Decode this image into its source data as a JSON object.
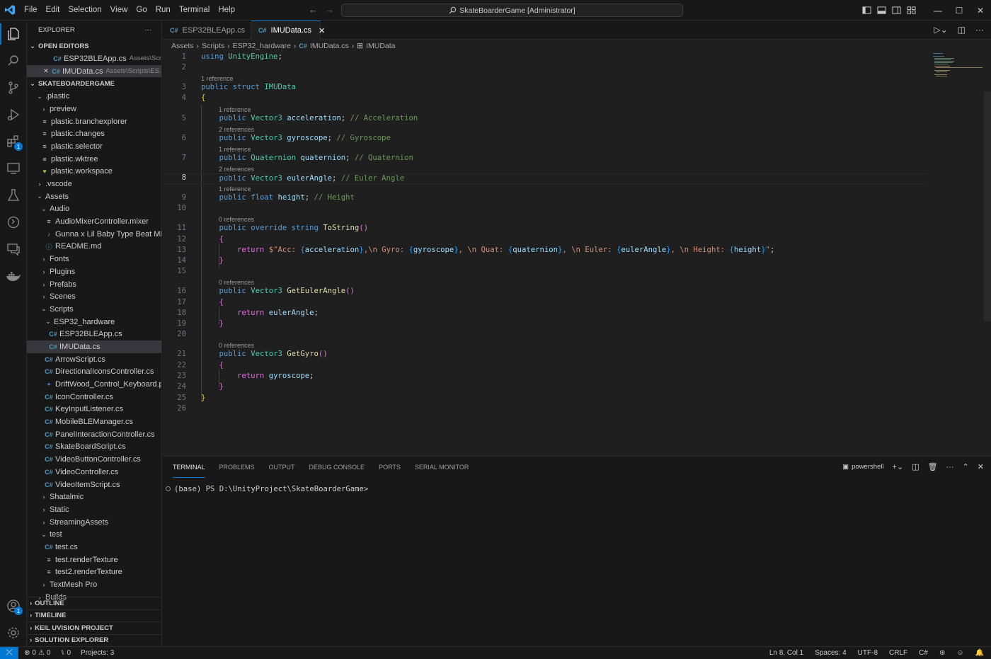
{
  "titlebar": {
    "menu": [
      "File",
      "Edit",
      "Selection",
      "View",
      "Go",
      "Run",
      "Terminal",
      "Help"
    ],
    "search": "SkateBoarderGame [Administrator]"
  },
  "activity": {
    "extensions_badge": "1",
    "accounts_badge": "1"
  },
  "sidebar": {
    "title": "EXPLORER",
    "open_editors_label": "OPEN EDITORS",
    "open_editors": [
      {
        "name": "ESP32BLEApp.cs",
        "path": "Assets\\Scrip..."
      },
      {
        "name": "IMUData.cs",
        "path": "Assets\\Scripts\\ES..."
      }
    ],
    "project_label": "SKATEBOARDERGAME",
    "tree": [
      {
        "label": ".plastic",
        "indent": 1,
        "kind": "folder-open"
      },
      {
        "label": "preview",
        "indent": 2,
        "kind": "folder"
      },
      {
        "label": "plastic.branchexplorer",
        "indent": 2,
        "kind": "file"
      },
      {
        "label": "plastic.changes",
        "indent": 2,
        "kind": "file"
      },
      {
        "label": "plastic.selector",
        "indent": 2,
        "kind": "file"
      },
      {
        "label": "plastic.wktree",
        "indent": 2,
        "kind": "file"
      },
      {
        "label": "plastic.workspace",
        "indent": 2,
        "kind": "heart"
      },
      {
        "label": ".vscode",
        "indent": 1,
        "kind": "folder"
      },
      {
        "label": "Assets",
        "indent": 1,
        "kind": "folder-open"
      },
      {
        "label": "Audio",
        "indent": 2,
        "kind": "folder-open"
      },
      {
        "label": "AudioMixerController.mixer",
        "indent": 3,
        "kind": "file"
      },
      {
        "label": "Gunna x Lil Baby Type Beat MP...",
        "indent": 3,
        "kind": "music"
      },
      {
        "label": "README.md",
        "indent": 3,
        "kind": "info"
      },
      {
        "label": "Fonts",
        "indent": 2,
        "kind": "folder"
      },
      {
        "label": "Plugins",
        "indent": 2,
        "kind": "folder"
      },
      {
        "label": "Prefabs",
        "indent": 2,
        "kind": "folder"
      },
      {
        "label": "Scenes",
        "indent": 2,
        "kind": "folder"
      },
      {
        "label": "Scripts",
        "indent": 2,
        "kind": "folder-open"
      },
      {
        "label": "ESP32_hardware",
        "indent": 3,
        "kind": "folder-open"
      },
      {
        "label": "ESP32BLEApp.cs",
        "indent": 4,
        "kind": "cs"
      },
      {
        "label": "IMUData.cs",
        "indent": 4,
        "kind": "cs",
        "selected": true
      },
      {
        "label": "ArrowScript.cs",
        "indent": 3,
        "kind": "cs"
      },
      {
        "label": "DirectionalIconsController.cs",
        "indent": 3,
        "kind": "cs"
      },
      {
        "label": "DriftWood_Control_Keyboard.py",
        "indent": 3,
        "kind": "py"
      },
      {
        "label": "IconController.cs",
        "indent": 3,
        "kind": "cs"
      },
      {
        "label": "KeyInputListener.cs",
        "indent": 3,
        "kind": "cs"
      },
      {
        "label": "MobileBLEManager.cs",
        "indent": 3,
        "kind": "cs"
      },
      {
        "label": "PanelInteractionController.cs",
        "indent": 3,
        "kind": "cs"
      },
      {
        "label": "SkateBoardScript.cs",
        "indent": 3,
        "kind": "cs"
      },
      {
        "label": "VideoButtonController.cs",
        "indent": 3,
        "kind": "cs"
      },
      {
        "label": "VideoController.cs",
        "indent": 3,
        "kind": "cs"
      },
      {
        "label": "VideoItemScript.cs",
        "indent": 3,
        "kind": "cs"
      },
      {
        "label": "Shatalmic",
        "indent": 2,
        "kind": "folder"
      },
      {
        "label": "Static",
        "indent": 2,
        "kind": "folder"
      },
      {
        "label": "StreamingAssets",
        "indent": 2,
        "kind": "folder"
      },
      {
        "label": "test",
        "indent": 2,
        "kind": "folder-open"
      },
      {
        "label": "test.cs",
        "indent": 3,
        "kind": "cs"
      },
      {
        "label": "test.renderTexture",
        "indent": 3,
        "kind": "file"
      },
      {
        "label": "test2.renderTexture",
        "indent": 3,
        "kind": "file"
      },
      {
        "label": "TextMesh Pro",
        "indent": 2,
        "kind": "folder"
      },
      {
        "label": "Builds",
        "indent": 1,
        "kind": "folder"
      }
    ],
    "bottom_sections": [
      "OUTLINE",
      "TIMELINE",
      "KEIL UVISION PROJECT",
      "SOLUTION EXPLORER"
    ]
  },
  "editor": {
    "tabs": [
      {
        "label": "ESP32BLEApp.cs",
        "active": false
      },
      {
        "label": "IMUData.cs",
        "active": true
      }
    ],
    "breadcrumb": [
      "Assets",
      "Scripts",
      "ESP32_hardware",
      "IMUData.cs",
      "IMUData"
    ],
    "code_lenses": {
      "l3": "1 reference",
      "l5": "1 reference",
      "l6": "2 references",
      "l7": "1 reference",
      "l8": "2 references",
      "l9": "1 reference",
      "l11": "0 references",
      "l16": "0 references",
      "l21": "0 references"
    },
    "line_numbers": [
      "1",
      "2",
      "3",
      "4",
      "5",
      "6",
      "7",
      "8",
      "9",
      "10",
      "11",
      "12",
      "13",
      "14",
      "15",
      "16",
      "17",
      "18",
      "19",
      "20",
      "21",
      "22",
      "23",
      "24",
      "25",
      "26"
    ],
    "current_line": "8"
  },
  "panel": {
    "tabs": [
      "TERMINAL",
      "PROBLEMS",
      "OUTPUT",
      "DEBUG CONSOLE",
      "PORTS",
      "SERIAL MONITOR"
    ],
    "shell": "powershell",
    "prompt": "(base) PS D:\\UnityProject\\SkateBoarderGame>"
  },
  "statusbar": {
    "errors": "0",
    "warnings": "0",
    "ports": "0",
    "projects": "Projects: 3",
    "position": "Ln 8, Col 1",
    "spaces": "Spaces: 4",
    "encoding": "UTF-8",
    "eol": "CRLF",
    "language": "C#"
  },
  "colors": {
    "accent": "#0078d4",
    "keyword": "#569cd6",
    "type": "#4ec9b0",
    "variable": "#9cdcfe",
    "function": "#dcdcaa",
    "comment": "#6a9955",
    "string": "#ce9178"
  }
}
